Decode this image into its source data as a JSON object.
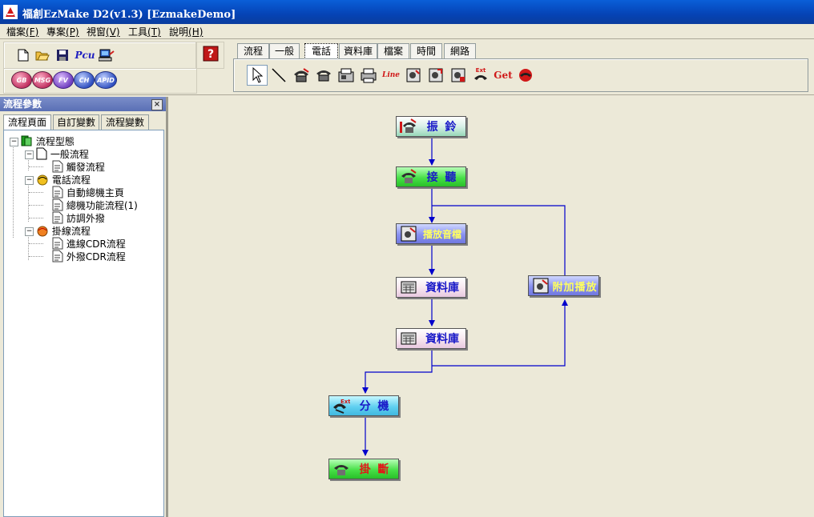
{
  "window": {
    "title": "福創EzMake D2(v1.3) [EzmakeDemo]"
  },
  "menubar": [
    {
      "label": "檔案",
      "key": "(F)"
    },
    {
      "label": "專案",
      "key": "(P)"
    },
    {
      "label": "視窗",
      "key": "(V)"
    },
    {
      "label": "工具",
      "key": "(T)"
    },
    {
      "label": "說明",
      "key": "(H)"
    }
  ],
  "toolbar": {
    "pcu_label": "Pcu",
    "circle_buttons": [
      "GB",
      "MSG",
      "FV",
      "CH",
      "APID"
    ]
  },
  "tabs": [
    "流程",
    "一般",
    "電話",
    "資料庫",
    "檔案",
    "時間",
    "網路"
  ],
  "active_tab": "電話",
  "palette": {
    "line_label": "Line",
    "ext_label": "Ext",
    "get_label": "Get"
  },
  "left_panel": {
    "title": "流程參數",
    "close": "×",
    "tabs": [
      "流程頁面",
      "自訂變數",
      "流程變數"
    ],
    "tree": {
      "root": "流程型態",
      "g1": "一般流程",
      "g1c1": "觸發流程",
      "g2": "電話流程",
      "g2c1": "自動總機主頁",
      "g2c2": "總機功能流程(1)",
      "g2c3": "訪調外撥",
      "g3": "掛線流程",
      "g3c1": "進線CDR流程",
      "g3c2": "外撥CDR流程"
    }
  },
  "flow": {
    "ring": "振 鈴",
    "answer": "接 聽",
    "play": "播放音檔",
    "db1": "資料庫",
    "db2": "資料庫",
    "append": "附加播放",
    "ext": "分 機",
    "hangup": "掛 斷"
  },
  "colors": {
    "titlebar": "#0a4fc8",
    "canvas": "#ece9d8",
    "connector": "#0000cc"
  }
}
